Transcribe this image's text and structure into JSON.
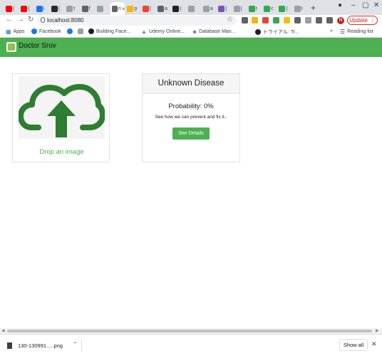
{
  "browser": {
    "tabs": [
      {
        "icon": "youtube-icon",
        "color": "#ff0000",
        "label": "("
      },
      {
        "icon": "youtube-icon",
        "color": "#ff0000",
        "label": "("
      },
      {
        "icon": "facebook-icon",
        "color": "#1877f2",
        "label": "i"
      },
      {
        "icon": "github-icon",
        "color": "#24292e",
        "label": "("
      },
      {
        "icon": "google-icon",
        "color": "#9aa0a6",
        "label": "t"
      },
      {
        "icon": "tool-icon",
        "color": "#5f6368",
        "label": "f"
      },
      {
        "icon": "google-icon",
        "color": "#9aa0a6",
        "label": ""
      },
      {
        "icon": "page-icon",
        "color": "#5f6368",
        "label": "ri"
      },
      {
        "icon": "page-icon",
        "color": "#f4b400",
        "label": "p"
      },
      {
        "icon": "page-icon",
        "color": "#ea4335",
        "label": "("
      },
      {
        "icon": "page-icon",
        "color": "#5f6368",
        "label": "a"
      },
      {
        "icon": "page-icon",
        "color": "#202124",
        "label": "("
      },
      {
        "icon": "google-icon",
        "color": "#9aa0a6",
        "label": ""
      },
      {
        "icon": "google-icon",
        "color": "#9aa0a6",
        "label": "a"
      },
      {
        "icon": "bootstrap-icon",
        "color": "#7952b3",
        "label": "("
      },
      {
        "icon": "google-icon",
        "color": "#9aa0a6",
        "label": "("
      },
      {
        "icon": "page-icon",
        "color": "#34a853",
        "label": "t"
      },
      {
        "icon": "page-icon",
        "color": "#34a853",
        "label": "c"
      },
      {
        "icon": "page-icon",
        "color": "#34a853",
        "label": "("
      },
      {
        "icon": "google-icon",
        "color": "#9aa0a6",
        "label": "t"
      }
    ],
    "url": "localhost:8080",
    "update_label": "Update",
    "avatar_letter": "N",
    "bookmarks": {
      "apps": "Apps",
      "facebook": "Facebook",
      "building": "Building Face...",
      "udemy": "Udemy Online...",
      "database": "Database Man...",
      "trial": "トライアル: Tr...",
      "reading_list": "Reading list"
    }
  },
  "app": {
    "brand": "Doctor Srov",
    "upload": {
      "label": "Drop an image"
    },
    "result": {
      "title": "Unknown Disease",
      "probability": "Probability: 0%",
      "description": "See how we can prevent and fix it..",
      "button": "See Details"
    }
  },
  "downloads": {
    "file": "130-130991.....png",
    "show_all": "Show all"
  },
  "colors": {
    "accent": "#4caf50",
    "upload_icon": "#2e7d32"
  }
}
